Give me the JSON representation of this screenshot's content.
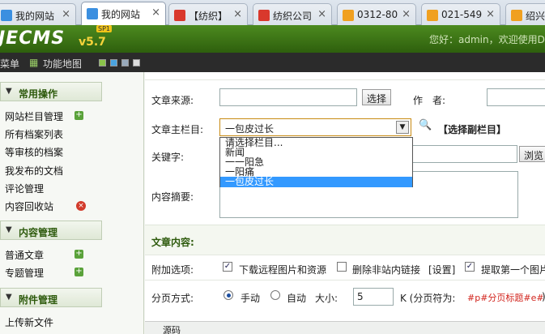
{
  "tabs": [
    {
      "label": "我的网站",
      "color": "#3b8fe0"
    },
    {
      "label": "我的网站",
      "color": "#3b8fe0",
      "active": true
    },
    {
      "label": "【纺织】",
      "color": "#d9382c"
    },
    {
      "label": "纺织公司",
      "color": "#d9382c"
    },
    {
      "label": "0312-80",
      "color": "#f0a020"
    },
    {
      "label": "021-549",
      "color": "#f0a020"
    },
    {
      "label": "绍兴",
      "color": "#f0a020"
    }
  ],
  "header": {
    "logo": "JECMS",
    "version": "v5.7",
    "badge": "SP1",
    "welcome": "您好：admin，欢迎使用D"
  },
  "toolbar": {
    "menu": "菜单",
    "sitemap": "功能地图"
  },
  "sidebar": {
    "sec1": "常用操作",
    "items1": [
      "网站栏目管理",
      "所有档案列表",
      "等审核的档案",
      "我发布的文档",
      "评论管理",
      "内容回收站"
    ],
    "sec2": "内容管理",
    "items2": [
      "普通文章",
      "专题管理"
    ],
    "sec3": "附件管理",
    "items3": [
      "上传新文件"
    ]
  },
  "form": {
    "source_label": "文章来源:",
    "select_btn": "选择",
    "author_label": "作　者:",
    "column_label": "文章主栏目:",
    "column_value": "一包皮过长",
    "sub_column": "【选择副栏目】",
    "keyword_label": "关键字:",
    "browse": "浏览",
    "summary_label": "内容摘要:",
    "options": [
      "请选择栏目...",
      "新闻",
      "一一阳急",
      "一阳痛",
      "一包皮过长"
    ],
    "content_title": "文章内容:",
    "extra_label": "附加选项:",
    "extra1": "下载远程图片和资源",
    "extra2": "删除非站内链接",
    "extra2b": "[设置]",
    "extra3": "提取第一个图片",
    "page_label": "分页方式:",
    "manual": "手动",
    "auto": "自动",
    "size_label": "大小:",
    "size_value": "5",
    "unit": "K (分页符为:",
    "page_sep": "#p#分页标题#e#",
    "paren": ")",
    "source_button": "源码"
  }
}
